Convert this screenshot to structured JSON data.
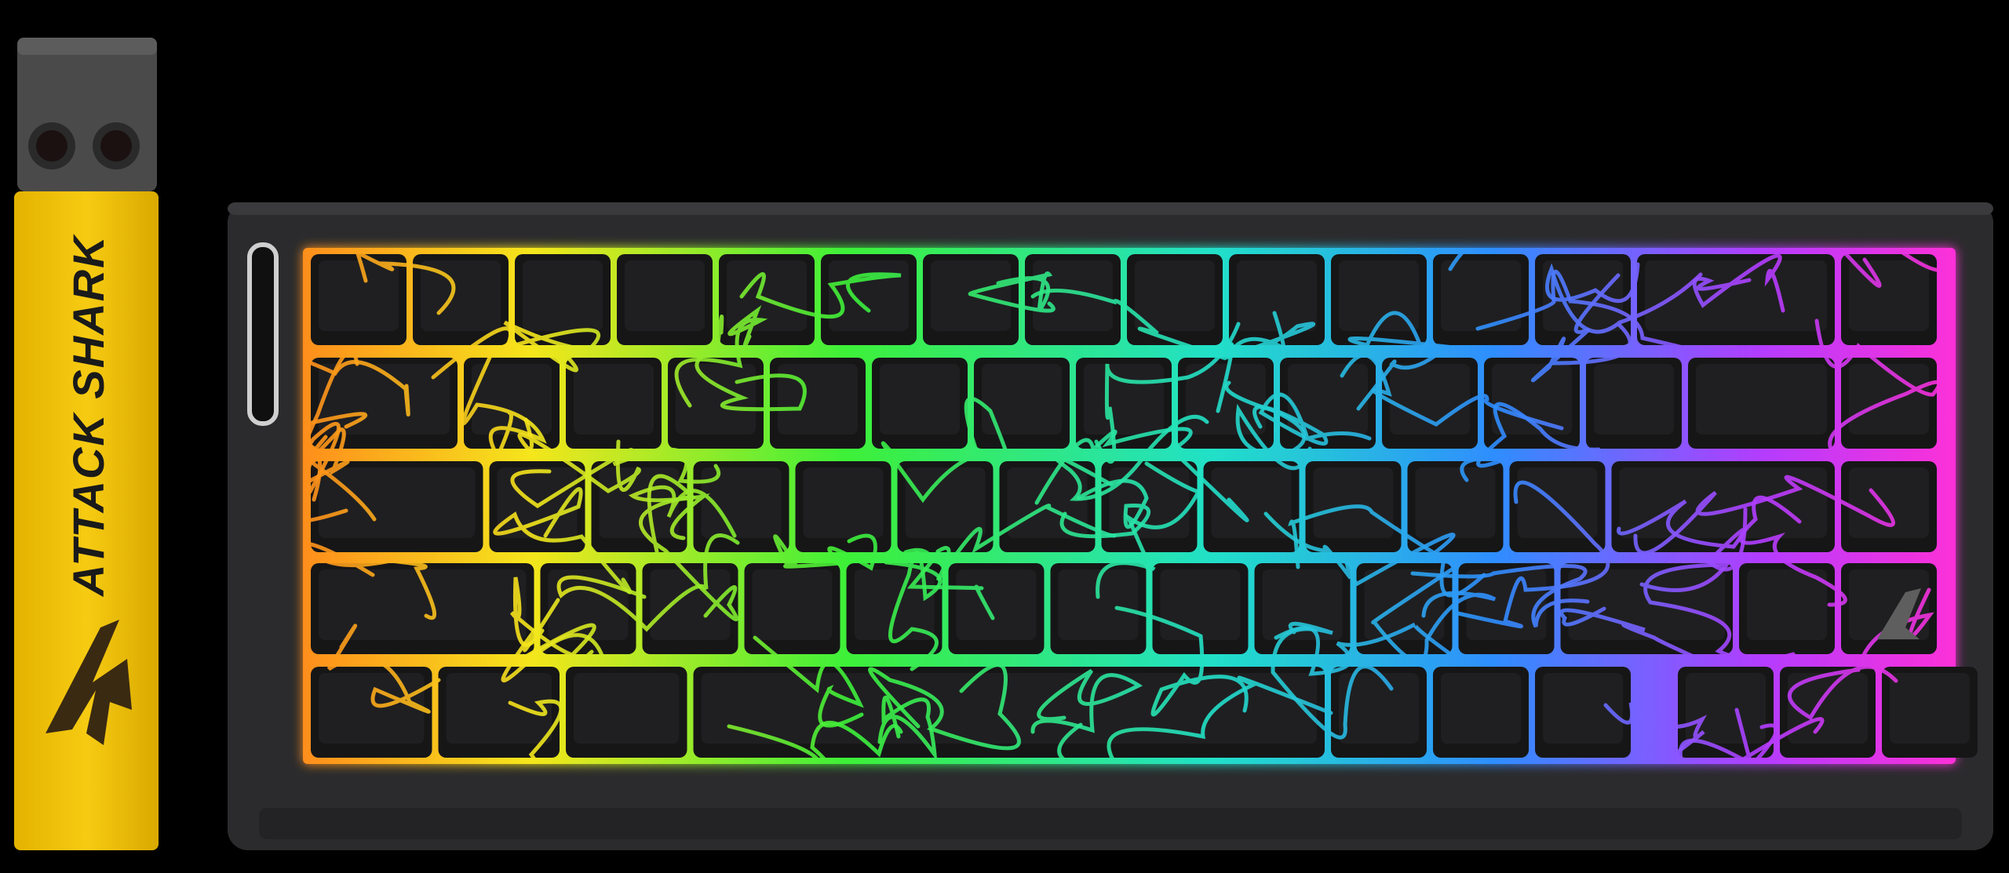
{
  "product": {
    "strap": {
      "brand_text": "ATTACK SHARK",
      "strap_color": "#f2c100",
      "clip_color": "#4a4a4a",
      "logo_color": "#3a2a12"
    },
    "keyboard": {
      "case_color": "#2b2b2d",
      "keycap_color": "#161617",
      "lighting": "rainbow",
      "gradient_colors": [
        "#ff8c1a",
        "#f5e61c",
        "#3df038",
        "#22e0c8",
        "#2f8dff",
        "#b43cff",
        "#ff2fd6"
      ],
      "badge_icon": "attack-shark-logo-icon"
    }
  }
}
